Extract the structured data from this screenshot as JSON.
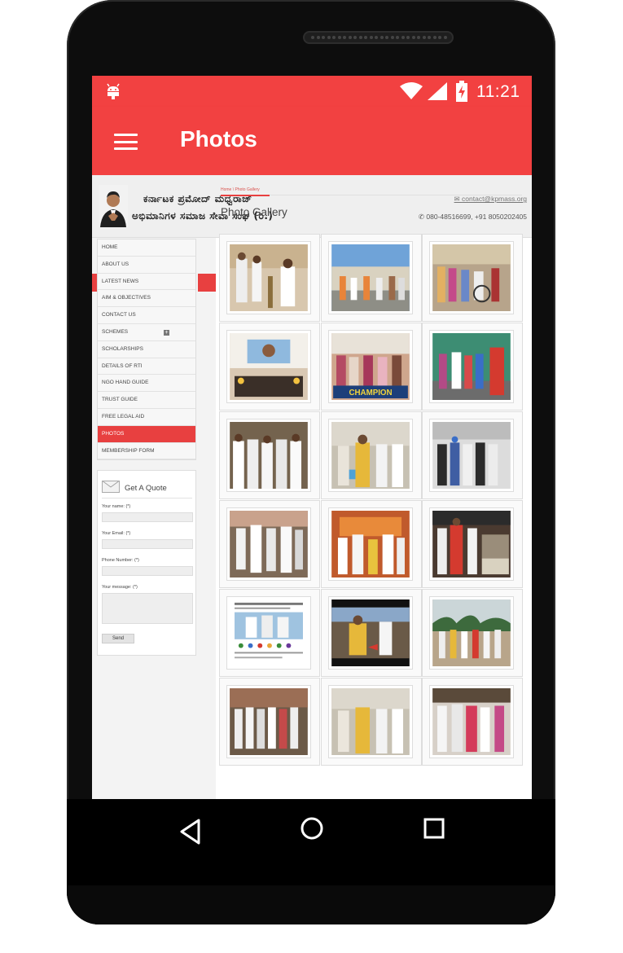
{
  "status_bar": {
    "time": "11:21"
  },
  "app_bar": {
    "title": "Photos"
  },
  "site": {
    "title_line1": "ಕರ್ನಾಟಕ ಪ್ರಮೋದ್ ಮಧ್ವರಾಜ್",
    "title_line2": "ಅಭಿಮಾನಿಗಳ ಸಮಾಜ ಸೇವಾ ಸಂಘ (ರಿ.)",
    "email": "contact@kpmass.org",
    "phone": "080-48516699, +91 8050202405"
  },
  "nav": {
    "items": [
      {
        "label": "HOME"
      },
      {
        "label": "ABOUT US"
      },
      {
        "label": "LATEST NEWS"
      },
      {
        "label": "AIM & OBJECTIVES"
      },
      {
        "label": "CONTACT US"
      },
      {
        "label": "SCHEMES"
      },
      {
        "label": "SCHOLARSHIPS"
      },
      {
        "label": "DETAILS OF RTI"
      },
      {
        "label": "NGO HAND GUIDE"
      },
      {
        "label": "TRUST GUIDE"
      },
      {
        "label": "FREE LEGAL AID"
      },
      {
        "label": "PHOTOS"
      },
      {
        "label": "MEMBERSHIP FORM"
      }
    ],
    "active_index": 11
  },
  "quote_form": {
    "title": "Get A Quote",
    "name_label": "Your name: (*)",
    "email_label": "Your Email: (*)",
    "phone_label": "Phone Number: (*)",
    "message_label": "Your message: (*)",
    "send_label": "Send"
  },
  "breadcrumb": "Home \\ Photo Gallery",
  "gallery": {
    "title": "Photo Gallery",
    "banner_text": "CHAMPION"
  },
  "colors": {
    "accent": "#f24141",
    "menu_active": "#e84040"
  }
}
